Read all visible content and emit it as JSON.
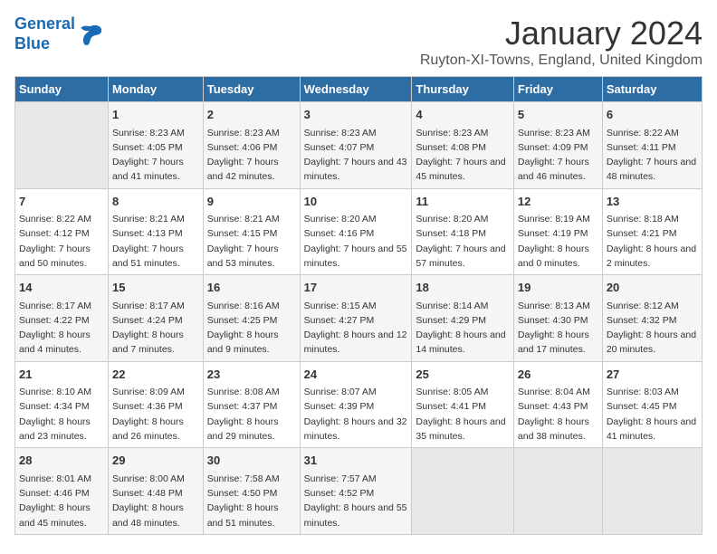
{
  "logo": {
    "line1": "General",
    "line2": "Blue"
  },
  "title": "January 2024",
  "subtitle": "Ruyton-XI-Towns, England, United Kingdom",
  "headers": [
    "Sunday",
    "Monday",
    "Tuesday",
    "Wednesday",
    "Thursday",
    "Friday",
    "Saturday"
  ],
  "weeks": [
    [
      {
        "day": "",
        "content": ""
      },
      {
        "day": "1",
        "content": "Sunrise: 8:23 AM\nSunset: 4:05 PM\nDaylight: 7 hours\nand 41 minutes."
      },
      {
        "day": "2",
        "content": "Sunrise: 8:23 AM\nSunset: 4:06 PM\nDaylight: 7 hours\nand 42 minutes."
      },
      {
        "day": "3",
        "content": "Sunrise: 8:23 AM\nSunset: 4:07 PM\nDaylight: 7 hours\nand 43 minutes."
      },
      {
        "day": "4",
        "content": "Sunrise: 8:23 AM\nSunset: 4:08 PM\nDaylight: 7 hours\nand 45 minutes."
      },
      {
        "day": "5",
        "content": "Sunrise: 8:23 AM\nSunset: 4:09 PM\nDaylight: 7 hours\nand 46 minutes."
      },
      {
        "day": "6",
        "content": "Sunrise: 8:22 AM\nSunset: 4:11 PM\nDaylight: 7 hours\nand 48 minutes."
      }
    ],
    [
      {
        "day": "7",
        "content": "Sunrise: 8:22 AM\nSunset: 4:12 PM\nDaylight: 7 hours\nand 50 minutes."
      },
      {
        "day": "8",
        "content": "Sunrise: 8:21 AM\nSunset: 4:13 PM\nDaylight: 7 hours\nand 51 minutes."
      },
      {
        "day": "9",
        "content": "Sunrise: 8:21 AM\nSunset: 4:15 PM\nDaylight: 7 hours\nand 53 minutes."
      },
      {
        "day": "10",
        "content": "Sunrise: 8:20 AM\nSunset: 4:16 PM\nDaylight: 7 hours\nand 55 minutes."
      },
      {
        "day": "11",
        "content": "Sunrise: 8:20 AM\nSunset: 4:18 PM\nDaylight: 7 hours\nand 57 minutes."
      },
      {
        "day": "12",
        "content": "Sunrise: 8:19 AM\nSunset: 4:19 PM\nDaylight: 8 hours\nand 0 minutes."
      },
      {
        "day": "13",
        "content": "Sunrise: 8:18 AM\nSunset: 4:21 PM\nDaylight: 8 hours\nand 2 minutes."
      }
    ],
    [
      {
        "day": "14",
        "content": "Sunrise: 8:17 AM\nSunset: 4:22 PM\nDaylight: 8 hours\nand 4 minutes."
      },
      {
        "day": "15",
        "content": "Sunrise: 8:17 AM\nSunset: 4:24 PM\nDaylight: 8 hours\nand 7 minutes."
      },
      {
        "day": "16",
        "content": "Sunrise: 8:16 AM\nSunset: 4:25 PM\nDaylight: 8 hours\nand 9 minutes."
      },
      {
        "day": "17",
        "content": "Sunrise: 8:15 AM\nSunset: 4:27 PM\nDaylight: 8 hours\nand 12 minutes."
      },
      {
        "day": "18",
        "content": "Sunrise: 8:14 AM\nSunset: 4:29 PM\nDaylight: 8 hours\nand 14 minutes."
      },
      {
        "day": "19",
        "content": "Sunrise: 8:13 AM\nSunset: 4:30 PM\nDaylight: 8 hours\nand 17 minutes."
      },
      {
        "day": "20",
        "content": "Sunrise: 8:12 AM\nSunset: 4:32 PM\nDaylight: 8 hours\nand 20 minutes."
      }
    ],
    [
      {
        "day": "21",
        "content": "Sunrise: 8:10 AM\nSunset: 4:34 PM\nDaylight: 8 hours\nand 23 minutes."
      },
      {
        "day": "22",
        "content": "Sunrise: 8:09 AM\nSunset: 4:36 PM\nDaylight: 8 hours\nand 26 minutes."
      },
      {
        "day": "23",
        "content": "Sunrise: 8:08 AM\nSunset: 4:37 PM\nDaylight: 8 hours\nand 29 minutes."
      },
      {
        "day": "24",
        "content": "Sunrise: 8:07 AM\nSunset: 4:39 PM\nDaylight: 8 hours\nand 32 minutes."
      },
      {
        "day": "25",
        "content": "Sunrise: 8:05 AM\nSunset: 4:41 PM\nDaylight: 8 hours\nand 35 minutes."
      },
      {
        "day": "26",
        "content": "Sunrise: 8:04 AM\nSunset: 4:43 PM\nDaylight: 8 hours\nand 38 minutes."
      },
      {
        "day": "27",
        "content": "Sunrise: 8:03 AM\nSunset: 4:45 PM\nDaylight: 8 hours\nand 41 minutes."
      }
    ],
    [
      {
        "day": "28",
        "content": "Sunrise: 8:01 AM\nSunset: 4:46 PM\nDaylight: 8 hours\nand 45 minutes."
      },
      {
        "day": "29",
        "content": "Sunrise: 8:00 AM\nSunset: 4:48 PM\nDaylight: 8 hours\nand 48 minutes."
      },
      {
        "day": "30",
        "content": "Sunrise: 7:58 AM\nSunset: 4:50 PM\nDaylight: 8 hours\nand 51 minutes."
      },
      {
        "day": "31",
        "content": "Sunrise: 7:57 AM\nSunset: 4:52 PM\nDaylight: 8 hours\nand 55 minutes."
      },
      {
        "day": "",
        "content": ""
      },
      {
        "day": "",
        "content": ""
      },
      {
        "day": "",
        "content": ""
      }
    ]
  ]
}
